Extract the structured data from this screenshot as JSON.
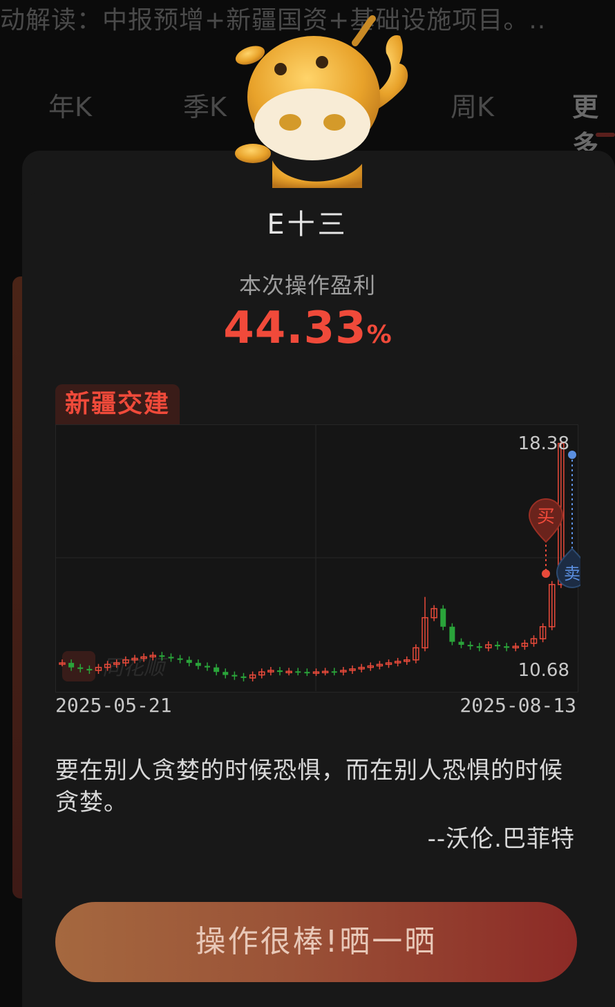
{
  "background": {
    "ticker_text": "动解读：中报预增+新疆国资+基础设施项目。..",
    "tabs": [
      "年K",
      "季K",
      "周K",
      "更多"
    ]
  },
  "modal": {
    "username": "E十三",
    "profit_label": "本次操作盈利",
    "profit_value": "44.33",
    "profit_unit": "%",
    "stock_name": "新疆交建",
    "chart": {
      "date_start": "2025-05-21",
      "date_end": "2025-08-13",
      "price_high_label": "18.38",
      "price_low_label": "10.68",
      "buy_marker": "买",
      "sell_marker": "卖",
      "watermark": "同花顺"
    },
    "quote_text": "要在别人贪婪的时候恐惧，而在别人恐惧的时候贪婪。",
    "quote_author": "--沃伦.巴菲特",
    "share_button": "操作很棒!晒一晒"
  },
  "colors": {
    "up": "#e84a3a",
    "down": "#2aa43a",
    "accent": "#f04a3a",
    "sell_line": "#5b8fe0"
  },
  "chart_data": {
    "type": "candlestick",
    "x_range": [
      "2025-05-21",
      "2025-08-13"
    ],
    "ylim": [
      10.68,
      18.38
    ],
    "closes": [
      11.1,
      10.95,
      10.9,
      10.85,
      10.95,
      11.05,
      11.1,
      11.2,
      11.25,
      11.3,
      11.35,
      11.3,
      11.25,
      11.2,
      11.1,
      11.0,
      10.95,
      10.8,
      10.7,
      10.65,
      10.6,
      10.7,
      10.8,
      10.85,
      10.8,
      10.82,
      10.8,
      10.78,
      10.8,
      10.82,
      10.8,
      10.85,
      10.9,
      10.95,
      11.0,
      11.05,
      11.1,
      11.15,
      11.2,
      11.6,
      12.6,
      12.9,
      12.3,
      11.8,
      11.7,
      11.65,
      11.6,
      11.7,
      11.65,
      11.6,
      11.65,
      11.75,
      11.9,
      12.3,
      13.7,
      18.38
    ],
    "buy_price": 13.5,
    "sell_price": 17.7
  }
}
